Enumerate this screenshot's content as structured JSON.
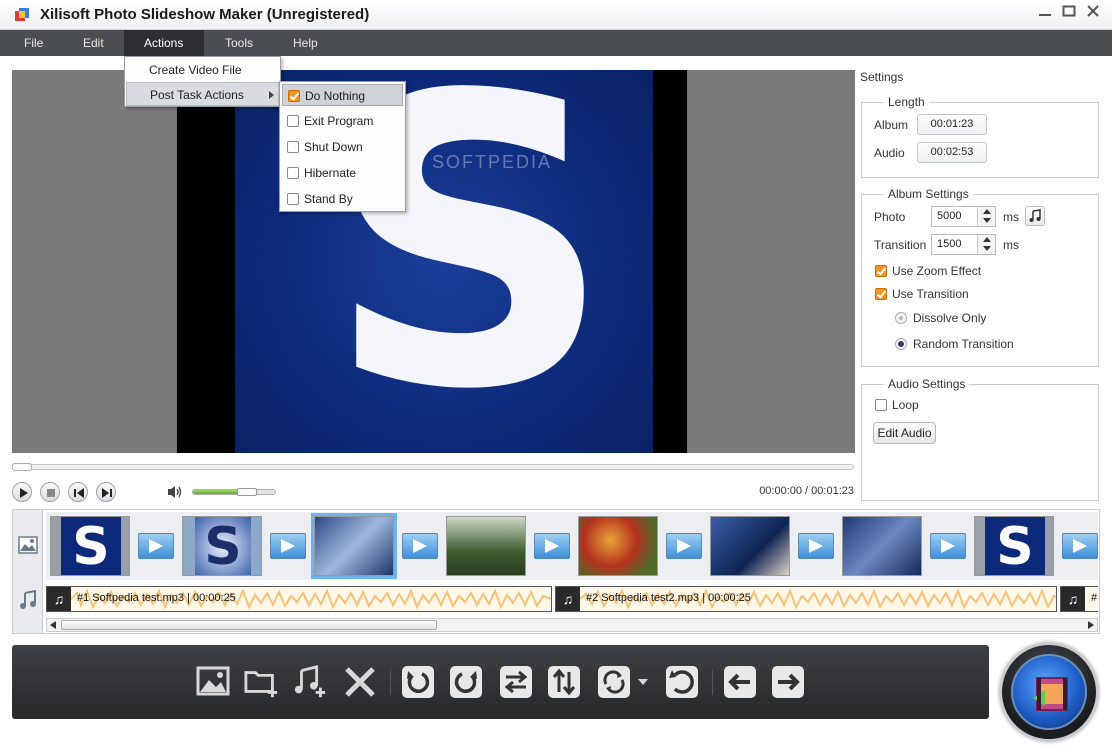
{
  "window": {
    "title": "Xilisoft Photo Slideshow Maker (Unregistered)"
  },
  "menubar": {
    "items": [
      "File",
      "Edit",
      "Actions",
      "Tools",
      "Help"
    ]
  },
  "actions_menu": {
    "items": [
      "Create Video File",
      "Post Task Actions"
    ]
  },
  "post_task_submenu": {
    "items": [
      {
        "label": "Do Nothing",
        "checked": true
      },
      {
        "label": "Exit Program",
        "checked": false
      },
      {
        "label": "Shut Down",
        "checked": false
      },
      {
        "label": "Hibernate",
        "checked": false
      },
      {
        "label": "Stand By",
        "checked": false
      }
    ]
  },
  "preview": {
    "watermark": "SOFTPEDIA",
    "letter": "S",
    "time": "00:00:00 / 00:01:23",
    "volume_level": 0.75
  },
  "settings": {
    "title": "Settings",
    "length": {
      "title": "Length",
      "album_label": "Album",
      "album_value": "00:01:23",
      "audio_label": "Audio",
      "audio_value": "00:02:53"
    },
    "album": {
      "title": "Album Settings",
      "photo_label": "Photo",
      "photo_value": "5000",
      "transition_label": "Transition",
      "transition_value": "1500",
      "ms": "ms",
      "zoom_label": "Use Zoom Effect",
      "zoom_checked": true,
      "use_transition_label": "Use Transition",
      "use_transition_checked": true,
      "dissolve_label": "Dissolve Only",
      "random_label": "Random Transition",
      "selected_transition": "Random Transition"
    },
    "audio": {
      "title": "Audio Settings",
      "loop_label": "Loop",
      "loop_checked": false,
      "edit_audio_label": "Edit Audio"
    }
  },
  "timeline": {
    "audio_clips": [
      "#1 Softpedia test.mp3 | 00:00:25",
      "#2 Softpedia test2.mp3 | 00:00:25",
      "#"
    ]
  },
  "colors": {
    "accent_orange": "#f7941d",
    "menubar": "#4a4d52",
    "toolbar": "#2f3236",
    "selection_blue": "#6fb3ee"
  }
}
